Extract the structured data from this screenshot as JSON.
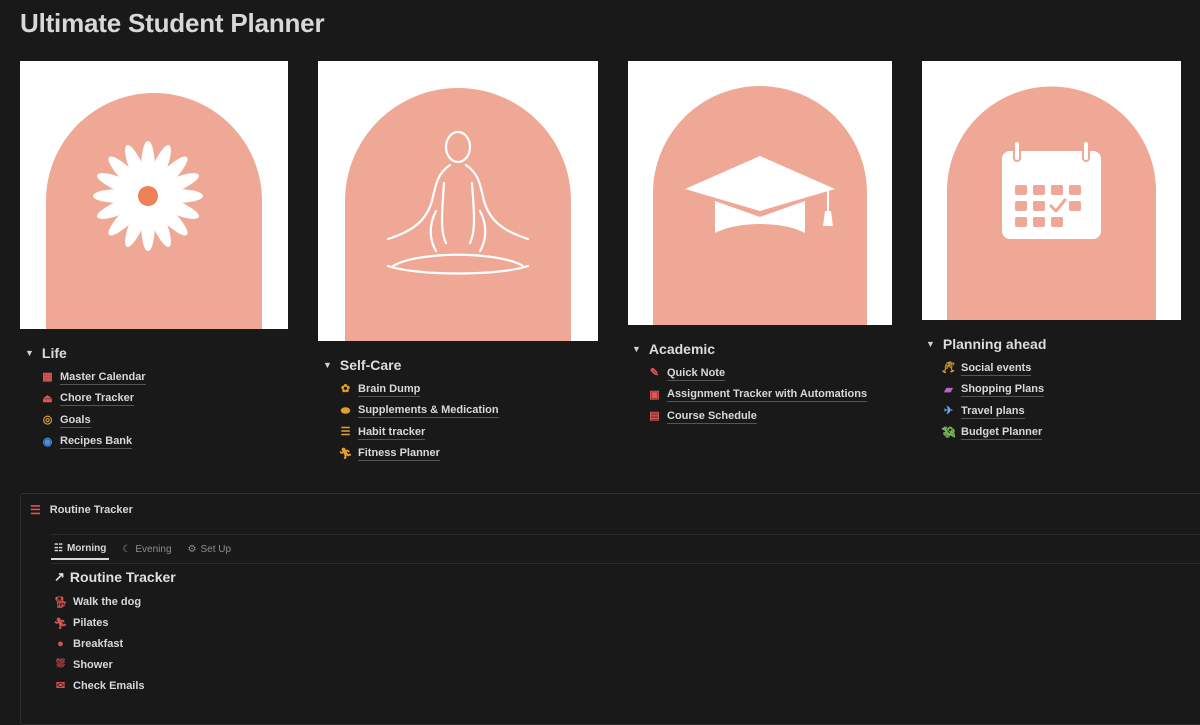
{
  "page": {
    "title": "Ultimate Student Planner"
  },
  "colors": {
    "arch": "#EFA896",
    "accent_orange": "#F08058",
    "red_icon": "#D9534F"
  },
  "sections": [
    {
      "name": "Life",
      "image_icon": "daisy-icon",
      "links": [
        {
          "label": "Master Calendar",
          "icon": "calendar-icon"
        },
        {
          "label": "Chore Tracker",
          "icon": "hanger-icon"
        },
        {
          "label": "Goals",
          "icon": "target-icon"
        },
        {
          "label": "Recipes Bank",
          "icon": "plate-icon"
        }
      ]
    },
    {
      "name": "Self-Care",
      "image_icon": "meditation-icon",
      "links": [
        {
          "label": "Brain Dump",
          "icon": "brain-icon"
        },
        {
          "label": "Supplements & Medication",
          "icon": "pill-icon"
        },
        {
          "label": "Habit tracker",
          "icon": "checklist-icon"
        },
        {
          "label": "Fitness Planner",
          "icon": "running-icon"
        }
      ]
    },
    {
      "name": "Academic",
      "image_icon": "graduation-cap-icon",
      "links": [
        {
          "label": "Quick Note",
          "icon": "note-icon"
        },
        {
          "label": "Assignment Tracker with Automations",
          "icon": "backpack-icon"
        },
        {
          "label": "Course Schedule",
          "icon": "schedule-icon"
        }
      ]
    },
    {
      "name": "Planning ahead",
      "image_icon": "calendar-check-icon",
      "links": [
        {
          "label": "Social events",
          "icon": "cheers-icon"
        },
        {
          "label": "Shopping Plans",
          "icon": "shopping-bags-icon"
        },
        {
          "label": "Travel plans",
          "icon": "airplane-icon"
        },
        {
          "label": "Budget Planner",
          "icon": "money-icon"
        }
      ]
    }
  ],
  "routine": {
    "header": "Routine Tracker",
    "tabs": [
      "Morning",
      "Evening",
      "Set Up"
    ],
    "active_tab": "Morning",
    "title": "Routine Tracker",
    "items": [
      {
        "label": "Walk the dog",
        "icon": "dog-icon"
      },
      {
        "label": "Pilates",
        "icon": "running-icon"
      },
      {
        "label": "Breakfast",
        "icon": "apple-icon"
      },
      {
        "label": "Shower",
        "icon": "shower-icon"
      },
      {
        "label": "Check Emails",
        "icon": "envelope-icon"
      }
    ]
  }
}
